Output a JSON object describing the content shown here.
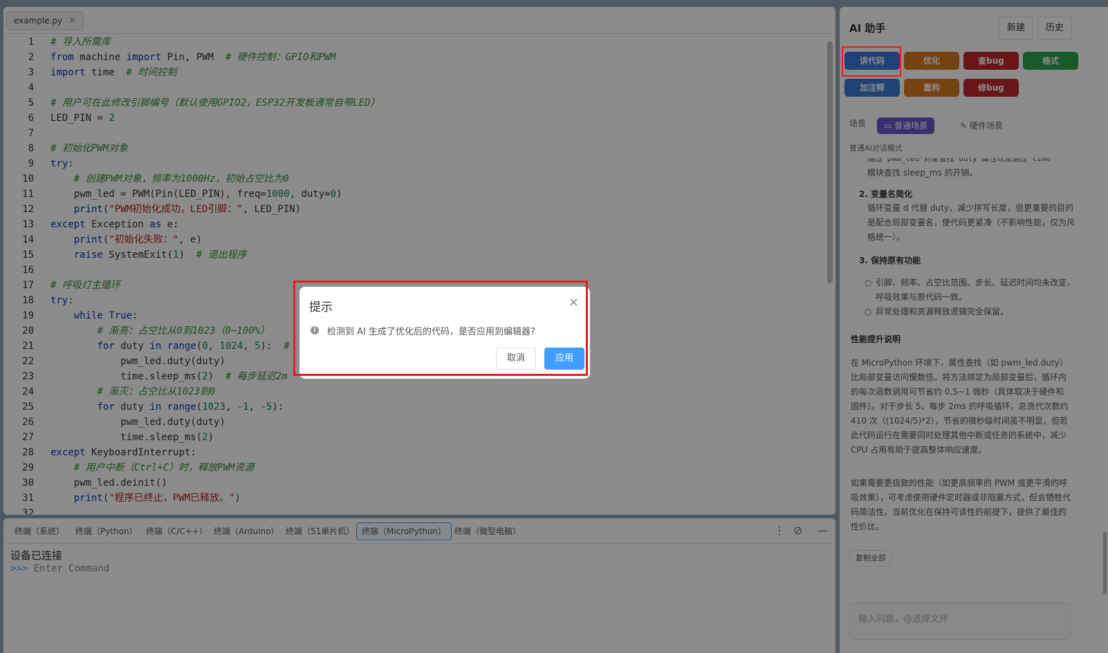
{
  "editor": {
    "file_tab": "example.py",
    "close_glyph": "×",
    "lines": [
      {
        "num": "1",
        "tokens": [
          {
            "t": "# 导入所需库",
            "c": "comment"
          }
        ]
      },
      {
        "num": "2",
        "tokens": [
          {
            "t": "from",
            "c": "keyword"
          },
          {
            "t": " machine ",
            "c": "plain"
          },
          {
            "t": "import",
            "c": "keyword"
          },
          {
            "t": " Pin, PWM  ",
            "c": "plain"
          },
          {
            "t": "# 硬件控制：GPIO和PWM",
            "c": "comment"
          }
        ]
      },
      {
        "num": "3",
        "tokens": [
          {
            "t": "import",
            "c": "keyword"
          },
          {
            "t": " time  ",
            "c": "plain"
          },
          {
            "t": "# 时间控制",
            "c": "comment"
          }
        ]
      },
      {
        "num": "4",
        "tokens": []
      },
      {
        "num": "5",
        "tokens": [
          {
            "t": "# 用户可在此修改引脚编号（默认使用GPIO2，ESP32开发板通常自带LED）",
            "c": "comment"
          }
        ]
      },
      {
        "num": "6",
        "tokens": [
          {
            "t": "LED_PIN = ",
            "c": "plain"
          },
          {
            "t": "2",
            "c": "number"
          }
        ]
      },
      {
        "num": "7",
        "tokens": []
      },
      {
        "num": "8",
        "tokens": [
          {
            "t": "# 初始化PWM对象",
            "c": "comment"
          }
        ]
      },
      {
        "num": "9",
        "tokens": [
          {
            "t": "try",
            "c": "keyword"
          },
          {
            "t": ":",
            "c": "plain"
          }
        ]
      },
      {
        "num": "10",
        "tokens": [
          {
            "t": "    ",
            "c": "plain"
          },
          {
            "t": "# 创建PWM对象，频率为1000Hz，初始占空比为0",
            "c": "comment"
          }
        ]
      },
      {
        "num": "11",
        "tokens": [
          {
            "t": "    pwm_led = PWM(Pin(LED_PIN), freq=",
            "c": "plain"
          },
          {
            "t": "1000",
            "c": "number"
          },
          {
            "t": ", duty=",
            "c": "plain"
          },
          {
            "t": "0",
            "c": "number"
          },
          {
            "t": ")",
            "c": "plain"
          }
        ]
      },
      {
        "num": "12",
        "tokens": [
          {
            "t": "    ",
            "c": "plain"
          },
          {
            "t": "print",
            "c": "keyword"
          },
          {
            "t": "(",
            "c": "plain"
          },
          {
            "t": "\"PWM初始化成功，LED引脚：\"",
            "c": "string"
          },
          {
            "t": ", LED_PIN)",
            "c": "plain"
          }
        ]
      },
      {
        "num": "13",
        "tokens": [
          {
            "t": "except",
            "c": "keyword"
          },
          {
            "t": " Exception ",
            "c": "plain"
          },
          {
            "t": "as",
            "c": "keyword"
          },
          {
            "t": " e:",
            "c": "plain"
          }
        ]
      },
      {
        "num": "14",
        "tokens": [
          {
            "t": "    ",
            "c": "plain"
          },
          {
            "t": "print",
            "c": "keyword"
          },
          {
            "t": "(",
            "c": "plain"
          },
          {
            "t": "\"初始化失败：\"",
            "c": "string"
          },
          {
            "t": ", e)",
            "c": "plain"
          }
        ]
      },
      {
        "num": "15",
        "tokens": [
          {
            "t": "    ",
            "c": "plain"
          },
          {
            "t": "raise",
            "c": "keyword"
          },
          {
            "t": " SystemExit(",
            "c": "plain"
          },
          {
            "t": "1",
            "c": "number"
          },
          {
            "t": ")  ",
            "c": "plain"
          },
          {
            "t": "# 退出程序",
            "c": "comment"
          }
        ]
      },
      {
        "num": "16",
        "tokens": []
      },
      {
        "num": "17",
        "tokens": [
          {
            "t": "# 呼吸灯主循环",
            "c": "comment"
          }
        ]
      },
      {
        "num": "18",
        "tokens": [
          {
            "t": "try",
            "c": "keyword"
          },
          {
            "t": ":",
            "c": "plain"
          }
        ]
      },
      {
        "num": "19",
        "tokens": [
          {
            "t": "    ",
            "c": "plain"
          },
          {
            "t": "while",
            "c": "keyword"
          },
          {
            "t": " ",
            "c": "plain"
          },
          {
            "t": "True",
            "c": "keyword"
          },
          {
            "t": ":",
            "c": "plain"
          }
        ]
      },
      {
        "num": "20",
        "tokens": [
          {
            "t": "        ",
            "c": "plain"
          },
          {
            "t": "# 渐亮：占空比从0到1023（0~100%）",
            "c": "comment"
          }
        ]
      },
      {
        "num": "21",
        "tokens": [
          {
            "t": "        ",
            "c": "plain"
          },
          {
            "t": "for",
            "c": "keyword"
          },
          {
            "t": " duty ",
            "c": "plain"
          },
          {
            "t": "in",
            "c": "keyword"
          },
          {
            "t": " ",
            "c": "plain"
          },
          {
            "t": "range",
            "c": "keyword"
          },
          {
            "t": "(",
            "c": "plain"
          },
          {
            "t": "0",
            "c": "number"
          },
          {
            "t": ", ",
            "c": "plain"
          },
          {
            "t": "1024",
            "c": "number"
          },
          {
            "t": ", ",
            "c": "plain"
          },
          {
            "t": "5",
            "c": "number"
          },
          {
            "t": "):  ",
            "c": "plain"
          },
          {
            "t": "#",
            "c": "comment"
          }
        ]
      },
      {
        "num": "22",
        "tokens": [
          {
            "t": "            pwm_led.duty(duty)",
            "c": "plain"
          }
        ]
      },
      {
        "num": "23",
        "tokens": [
          {
            "t": "            time.sleep_ms(",
            "c": "plain"
          },
          {
            "t": "2",
            "c": "number"
          },
          {
            "t": ")  ",
            "c": "plain"
          },
          {
            "t": "# 每步延迟2m",
            "c": "comment"
          }
        ]
      },
      {
        "num": "24",
        "tokens": [
          {
            "t": "        ",
            "c": "plain"
          },
          {
            "t": "# 渐灭：占空比从1023到0",
            "c": "comment"
          }
        ]
      },
      {
        "num": "25",
        "tokens": [
          {
            "t": "        ",
            "c": "plain"
          },
          {
            "t": "for",
            "c": "keyword"
          },
          {
            "t": " duty ",
            "c": "plain"
          },
          {
            "t": "in",
            "c": "keyword"
          },
          {
            "t": " ",
            "c": "plain"
          },
          {
            "t": "range",
            "c": "keyword"
          },
          {
            "t": "(",
            "c": "plain"
          },
          {
            "t": "1023",
            "c": "number"
          },
          {
            "t": ", ",
            "c": "plain"
          },
          {
            "t": "-1",
            "c": "number"
          },
          {
            "t": ", ",
            "c": "plain"
          },
          {
            "t": "-5",
            "c": "number"
          },
          {
            "t": "):",
            "c": "plain"
          }
        ]
      },
      {
        "num": "26",
        "tokens": [
          {
            "t": "            pwm_led.duty(duty)",
            "c": "plain"
          }
        ]
      },
      {
        "num": "27",
        "tokens": [
          {
            "t": "            time.sleep_ms(",
            "c": "plain"
          },
          {
            "t": "2",
            "c": "number"
          },
          {
            "t": ")",
            "c": "plain"
          }
        ]
      },
      {
        "num": "28",
        "tokens": [
          {
            "t": "except",
            "c": "keyword"
          },
          {
            "t": " KeyboardInterrupt:",
            "c": "plain"
          }
        ]
      },
      {
        "num": "29",
        "tokens": [
          {
            "t": "    ",
            "c": "plain"
          },
          {
            "t": "# 用户中断（Ctrl+C）时，释放PWM资源",
            "c": "comment"
          }
        ]
      },
      {
        "num": "30",
        "tokens": [
          {
            "t": "    pwm_led.deinit()",
            "c": "plain"
          }
        ]
      },
      {
        "num": "31",
        "tokens": [
          {
            "t": "    ",
            "c": "plain"
          },
          {
            "t": "print",
            "c": "keyword"
          },
          {
            "t": "(",
            "c": "plain"
          },
          {
            "t": "\"程序已终止，PWM已释放。\"",
            "c": "string"
          },
          {
            "t": ")",
            "c": "plain"
          }
        ]
      },
      {
        "num": "32",
        "tokens": []
      }
    ]
  },
  "terminal": {
    "tabs": [
      "终端（系统）",
      "终端（Python）",
      "终端（C/C++）",
      "终端（Arduino）",
      "终端（51单片机）",
      "终端（MicroPython）",
      "终端（微型电脑）"
    ],
    "active_tab": 5,
    "status_line": "设备已连接",
    "prompt": ">>>",
    "placeholder": "Enter Command",
    "more_glyph": "⋮",
    "clear_glyph": "⊘",
    "minimize_glyph": "—"
  },
  "ai": {
    "title": "AI 助手",
    "new_label": "新建",
    "history_label": "历史",
    "actions": [
      {
        "label": "讲代码",
        "color": "#3a7bd5"
      },
      {
        "label": "优化",
        "color": "#d9781f"
      },
      {
        "label": "查bug",
        "color": "#c0282e"
      },
      {
        "label": "格式",
        "color": "#2ea44f"
      },
      {
        "label": "加注释",
        "color": "#3a7bd5"
      },
      {
        "label": "重构",
        "color": "#d9781f"
      },
      {
        "label": "修bug",
        "color": "#c0282e"
      }
    ],
    "scene_label": "场景",
    "scene_normal": "普通场景",
    "scene_hardware": "硬件场景",
    "mode_text": "普通AI对话模式",
    "content": {
      "cut_top": "通过 pwm_led 对象查找 duty 属性以及通过 time",
      "cut_top2": "模块查找 sleep_ms 的开销。",
      "item2_title": "2. 变量名简化",
      "item2_body": "循环变量 d 代替 duty，减少拼写长度，但更重要的目的是配合局部变量名，使代码更紧凑（不影响性能，仅为风格统一）。",
      "item3_title": "3. 保持原有功能",
      "bullet1": "引脚、频率、占空比范围、步长、延迟时间均未改变，呼吸效果与原代码一致。",
      "bullet2": "异常处理和资源释放逻辑完全保留。",
      "perf_title": "性能提升说明",
      "perf_p1": "在 MicroPython 环境下，属性查找（如 pwm_led.duty）比局部变量访问慢数倍。将方法绑定为局部变量后，循环内的每次函数调用可节省约 0.5~1 微秒（具体取决于硬件和固件）。对于步长 5、每步 2ms 的呼吸循环，总迭代次数约 410 次（(1024/5)*2），节省的微秒级时间虽不明显，但若此代码运行在需要同时处理其他中断或任务的系统中，减少 CPU 占用有助于提高整体响应速度。",
      "perf_p2": "如果需要更极致的性能（如更高频率的 PWM 或更平滑的呼吸效果），可考虑使用硬件定时器或非阻塞方式，但会牺牲代码简洁性。当前优化在保持可读性的前提下，提供了最佳的性价比。"
    },
    "copy_all": "复制全部",
    "input_placeholder": "输入问题，@选择文件"
  },
  "modal": {
    "title": "提示",
    "close_glyph": "×",
    "icon_glyph": "i",
    "message": "检测到 AI 生成了优化后的代码，是否应用到编辑器?",
    "cancel_label": "取消",
    "apply_label": "应用",
    "apply_color": "#409eff"
  },
  "colors": {
    "highlight": "#e02020",
    "scene_active_bg": "#6a56c9"
  }
}
